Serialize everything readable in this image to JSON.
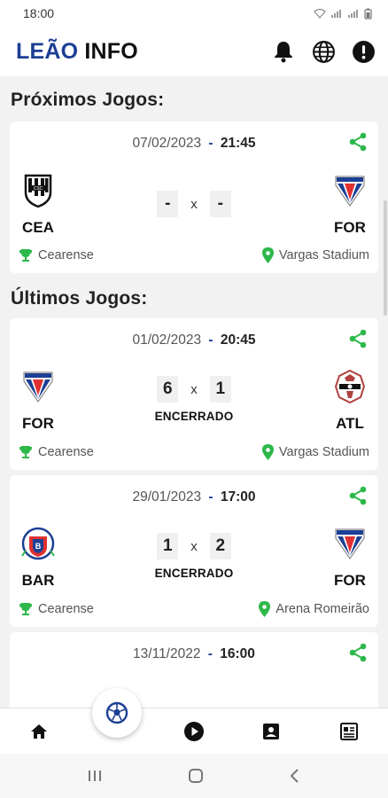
{
  "status_bar": {
    "time": "18:00"
  },
  "app": {
    "title_part1": "LEÃO",
    "title_part2": "INFO"
  },
  "sections": {
    "upcoming": "Próximos Jogos:",
    "recent": "Últimos Jogos:"
  },
  "match_labels": {
    "vs": "x"
  },
  "matches": [
    {
      "date": "07/02/2023",
      "sep": "-",
      "time": "21:45",
      "home": "CEA",
      "away": "FOR",
      "home_score": "-",
      "away_score": "-",
      "status": "",
      "competition": "Cearense",
      "venue": "Vargas Stadium"
    },
    {
      "date": "01/02/2023",
      "sep": "-",
      "time": "20:45",
      "home": "FOR",
      "away": "ATL",
      "home_score": "6",
      "away_score": "1",
      "status": "ENCERRADO",
      "competition": "Cearense",
      "venue": "Vargas Stadium"
    },
    {
      "date": "29/01/2023",
      "sep": "-",
      "time": "17:00",
      "home": "BAR",
      "away": "FOR",
      "home_score": "1",
      "away_score": "2",
      "status": "ENCERRADO",
      "competition": "Cearense",
      "venue": "Arena Romeirão"
    },
    {
      "date": "13/11/2022",
      "sep": "-",
      "time": "16:00"
    }
  ],
  "colors": {
    "brand_blue": "#1c3f94",
    "share_green": "#2db84a",
    "pin_green": "#2db84a",
    "trophy_green": "#2db84a"
  },
  "icons": {
    "appbar": [
      "bell-icon",
      "globe-icon",
      "alert-icon"
    ],
    "card": [
      "share-icon",
      "trophy-icon",
      "location-pin-icon"
    ],
    "bottom_nav": [
      "home-icon",
      "soccer-ball-icon",
      "play-icon",
      "profile-card-icon",
      "news-icon"
    ]
  }
}
